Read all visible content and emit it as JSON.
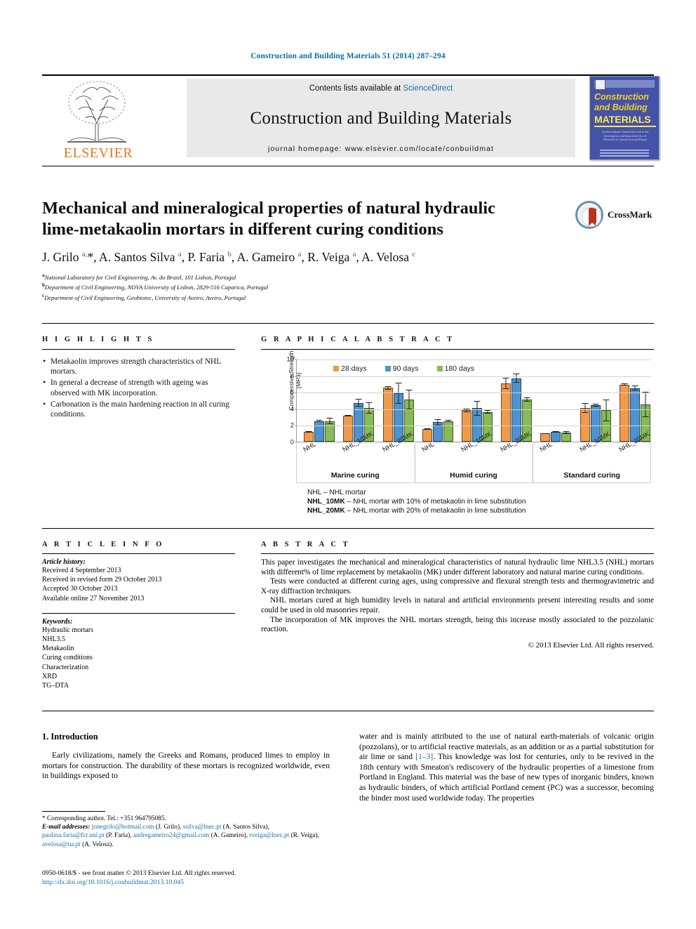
{
  "running_head": "Construction and Building Materials 51 (2014) 287–294",
  "masthead": {
    "contents_prefix": "Contents lists available at ",
    "sciencedirect": "ScienceDirect",
    "journal_name": "Construction and Building Materials",
    "homepage": "journal homepage: www.elsevier.com/locate/conbuildmat",
    "publisher": "ELSEVIER",
    "cover": {
      "line1": "Construction",
      "line2": "and Building",
      "line3": "MATERIALS",
      "blurb": "An International Journal Devoted to the Investigation and Innovative Use of Materials in Construction and Repair"
    }
  },
  "article": {
    "title": "Mechanical and mineralogical properties of natural hydraulic lime-metakaolin mortars in different curing conditions",
    "crossmark_label": "CrossMark",
    "authors_html": "J. Grilo <sup>a,</sup>*, A. Santos Silva <sup>a</sup>, P. Faria <sup>b</sup>, A. Gameiro <sup>a</sup>, R. Veiga <sup>a</sup>, A. Velosa <sup>c</sup>",
    "affiliations": [
      {
        "mark": "a",
        "text": "National Laboratory for Civil Engineering, Av. do Brasil, 101 Lisbon, Portugal"
      },
      {
        "mark": "b",
        "text": "Department of Civil Engineering, NOVA University of Lisbon, 2829-516 Caparica, Portugal"
      },
      {
        "mark": "c",
        "text": "Department of Civil Engineering, Geobiotec, University of Aveiro, Aveiro, Portugal"
      }
    ]
  },
  "highlights": {
    "heading": "H I G H L I G H T S",
    "items": [
      "Metakaolin improves strength characteristics of NHL mortars.",
      "In general a decrease of strength with ageing was observed with MK incorporation.",
      "Carbonation is the main hardening reaction in all curing conditions."
    ]
  },
  "graphical_abstract": {
    "heading": "G R A P H I C A L  A B S T R A C T",
    "notes": [
      {
        "term": "NHL",
        "def": " – NHL mortar"
      },
      {
        "term": "NHL_10MK",
        "def": " – NHL mortar with 10% of metakaolin in lime substitution"
      },
      {
        "term": "NHL_20MK",
        "def": " – NHL mortar with 20% of metakaolin in lime substitution"
      }
    ]
  },
  "chart_data": {
    "type": "bar",
    "title": "",
    "ylabel": "Compressive Strength [MPa]",
    "xlabel": "",
    "ylim": [
      0,
      10
    ],
    "yticks": [
      0,
      2,
      4,
      6,
      8,
      10
    ],
    "grid": true,
    "legend_position": "top-left",
    "panels": [
      "Marine curing",
      "Humid curing",
      "Standard curing"
    ],
    "categories": [
      "NHL",
      "NHL_10MK",
      "NHL_20MK"
    ],
    "series": [
      {
        "name": "28 days",
        "color": "#F09B4B"
      },
      {
        "name": "90 days",
        "color": "#4E93CE"
      },
      {
        "name": "180 days",
        "color": "#86BB56"
      }
    ],
    "groups": [
      {
        "panel": "Marine curing",
        "bars": [
          {
            "category": "NHL",
            "values": [
              1.2,
              2.5,
              2.5
            ],
            "errors": [
              0.1,
              0.15,
              0.35
            ]
          },
          {
            "category": "NHL_10MK",
            "values": [
              3.15,
              4.7,
              4.05
            ],
            "errors": [
              0.1,
              0.5,
              0.7
            ]
          },
          {
            "category": "NHL_20MK",
            "values": [
              6.5,
              5.85,
              5.1
            ],
            "errors": [
              0.2,
              1.3,
              1.2
            ]
          }
        ]
      },
      {
        "panel": "Humid curing",
        "bars": [
          {
            "category": "NHL",
            "values": [
              1.5,
              2.35,
              2.5
            ],
            "errors": [
              0.1,
              0.4,
              0.1
            ]
          },
          {
            "category": "NHL_10MK",
            "values": [
              3.8,
              4.05,
              3.6
            ],
            "errors": [
              0.2,
              0.9,
              0.25
            ]
          },
          {
            "category": "NHL_20MK",
            "values": [
              7.05,
              7.65,
              5.1
            ],
            "errors": [
              0.7,
              0.55,
              0.25
            ]
          }
        ]
      },
      {
        "panel": "Standard curing",
        "bars": [
          {
            "category": "NHL",
            "values": [
              1.0,
              1.2,
              1.1
            ],
            "errors": [
              0.05,
              0.1,
              0.15
            ]
          },
          {
            "category": "NHL_10MK",
            "values": [
              4.1,
              4.4,
              3.8
            ],
            "errors": [
              0.6,
              0.2,
              1.3
            ]
          },
          {
            "category": "NHL_20MK",
            "values": [
              6.9,
              6.45,
              4.5
            ],
            "errors": [
              0.1,
              0.3,
              1.5
            ]
          }
        ]
      }
    ]
  },
  "article_info": {
    "heading": "A R T I C L E  I N F O",
    "history_title": "Article history:",
    "history": [
      "Received 4 September 2013",
      "Received in revised form 29 October 2013",
      "Accepted 30 October 2013",
      "Available online 27 November 2013"
    ],
    "keywords_title": "Keywords:",
    "keywords": [
      "Hydraulic mortars",
      "NHL3.5",
      "Metakaolin",
      "Curing conditions",
      "Characterization",
      "XRD",
      "TG–DTA"
    ]
  },
  "abstract": {
    "heading": "A B S T R A C T",
    "paragraphs": [
      "This paper investigates the mechanical and mineralogical characteristics of natural hydraulic lime NHL3.5 (NHL) mortars with different% of lime replacement by metakaolin (MK) under different laboratory and natural marine curing conditions.",
      "Tests were conducted at different curing ages, using compressive and flexural strength tests and thermogravimetric and X-ray diffraction techniques.",
      "NHL mortars cured at high humidity levels in natural and artificial environments present interesting results and some could be used in old masonries repair.",
      "The incorporation of MK improves the NHL mortars strength, being this increase mostly associated to the pozzolanic reaction."
    ],
    "copyright": "© 2013 Elsevier Ltd. All rights reserved."
  },
  "introduction": {
    "heading": "1. Introduction",
    "left_paragraph": "Early civilizations, namely the Greeks and Romans, produced limes to employ in mortars for construction. The durability of these mortars is recognized worldwide, even in buildings exposed to",
    "right_paragraph_part1": "water and is mainly attributed to the use of natural earth-materials of volcanic origin (pozzolans), or to artificial reactive materials, as an addition or as a partial substitution for air lime or sand ",
    "right_citation": "[1–3]",
    "right_paragraph_part2": ". This knowledge was lost for centuries, only to be revived in the 18th century with Smeaton's rediscovery of the hydraulic properties of a limestone from Portland in England. This material was the base of new types of inorganic binders, known as hydraulic binders, of which artificial Portland cement (PC) was a successor, becoming the binder most used worldwide today. The properties"
  },
  "footnote": {
    "corresponding": "* Corresponding author. Tel.: +351 964795085.",
    "emails_label": "E-mail addresses:",
    "emails": [
      {
        "addr": "jonegrilo@hotmail.com",
        "who": " (J. Grilo), "
      },
      {
        "addr": "ssilva@lnec.pt",
        "who": " (A. Santos Silva), "
      },
      {
        "addr": "paulina.faria@fct.unl.pt",
        "who": " (P. Faria), "
      },
      {
        "addr": "andregameiro24@gmail.com",
        "who": " (A. Gameiro), "
      },
      {
        "addr": "rveiga@lnec.pt",
        "who": " (R. Veiga), "
      },
      {
        "addr": "avelosa@ua.pt",
        "who": " (A. Velosa)."
      }
    ]
  },
  "bottom": {
    "issn_line": "0950-0618/$ - see front matter © 2013 Elsevier Ltd. All rights reserved.",
    "doi": "http://dx.doi.org/10.1016/j.conbuildmat.2013.10.045"
  }
}
